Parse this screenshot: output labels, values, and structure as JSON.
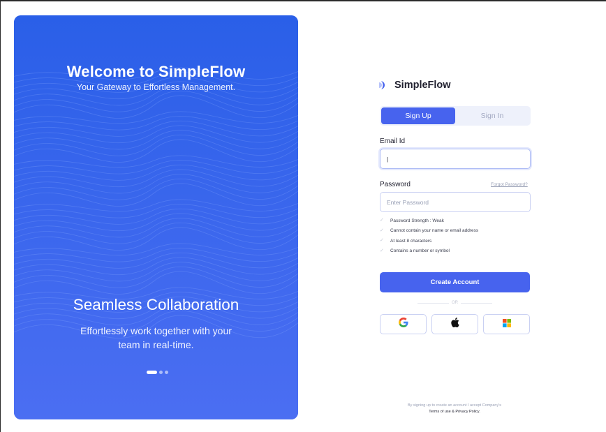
{
  "hero": {
    "title": "Welcome to SimpleFlow",
    "subtitle": "Your Gateway to Effortless Management.",
    "heading": "Seamless Collaboration",
    "text_line1": "Effortlessly work together with your",
    "text_line2": "team in real-time.",
    "carousel": {
      "count": 3,
      "active_index": 0
    },
    "background_color": "#3a6cf2"
  },
  "brand": {
    "name": "SimpleFlow",
    "accent": "#4763ee"
  },
  "tabs": [
    {
      "label": "Sign Up",
      "active": true
    },
    {
      "label": "Sign In",
      "active": false
    }
  ],
  "form": {
    "email_label": "Email Id",
    "email_value": "|",
    "password_label": "Password",
    "password_placeholder": "Enter Password",
    "forgot_link": "Forgot Password?",
    "rules": [
      "Password Strength : Weak",
      "Cannot contain your name or email address",
      "At least 8 characters",
      "Contains a number or symbol"
    ],
    "create_button": "Create Account",
    "or_label": "OR",
    "social": [
      "google-icon",
      "apple-icon",
      "microsoft-icon"
    ]
  },
  "footer": {
    "line1": "By signing up to create an account I accept Company's",
    "line2": "Terms of use & Privacy Policy."
  }
}
